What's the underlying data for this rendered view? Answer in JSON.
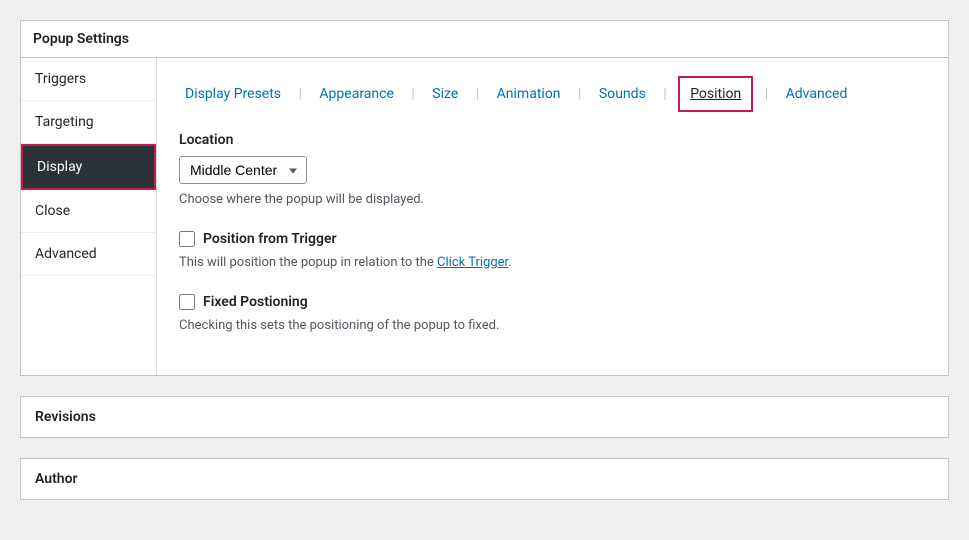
{
  "panelTitle": "Popup Settings",
  "sideNav": {
    "triggers": "Triggers",
    "targeting": "Targeting",
    "display": "Display",
    "close": "Close",
    "advanced": "Advanced"
  },
  "subtabs": {
    "displayPresets": "Display Presets",
    "appearance": "Appearance",
    "size": "Size",
    "animation": "Animation",
    "sounds": "Sounds",
    "position": "Position",
    "advanced": "Advanced"
  },
  "location": {
    "label": "Location",
    "selected": "Middle Center",
    "description": "Choose where the popup will be displayed."
  },
  "positionFromTrigger": {
    "label": "Position from Trigger",
    "descriptionPrefix": "This will position the popup in relation to the ",
    "linkText": "Click Trigger",
    "descriptionSuffix": "."
  },
  "fixedPositioning": {
    "label": "Fixed Postioning",
    "description": "Checking this sets the positioning of the popup to fixed."
  },
  "revisionsTitle": "Revisions",
  "authorTitle": "Author"
}
